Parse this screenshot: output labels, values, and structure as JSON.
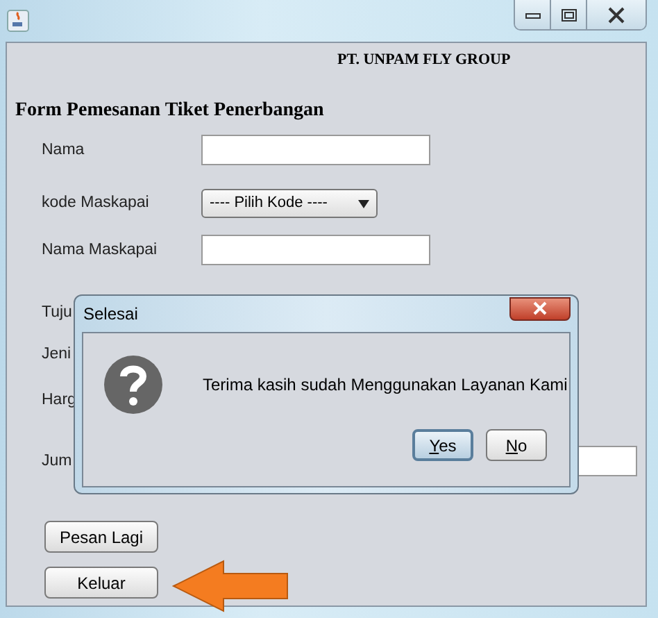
{
  "company": "PT. UNPAM FLY GROUP",
  "form_title": "Form Pemesanan Tiket Penerbangan",
  "fields": [
    {
      "kind": "text",
      "label": "Nama"
    },
    {
      "kind": "combo",
      "label": "kode Maskapai",
      "value": "---- Pilih Kode ----"
    },
    {
      "kind": "text",
      "label": "Nama Maskapai"
    },
    {
      "kind": "hidden",
      "label": "Tuju"
    },
    {
      "kind": "hidden",
      "label": "Jeni"
    },
    {
      "kind": "hidden",
      "label": "Harg"
    },
    {
      "kind": "partial",
      "label": "Jum"
    }
  ],
  "buttons": [
    "Pesan Lagi",
    "Keluar"
  ],
  "dialog": {
    "title": "Selesai",
    "message": "Terima kasih sudah Menggunakan Layanan Kami",
    "buttons": [
      {
        "label": "Yes",
        "selected": true
      },
      {
        "label": "No",
        "selected": false
      }
    ]
  }
}
